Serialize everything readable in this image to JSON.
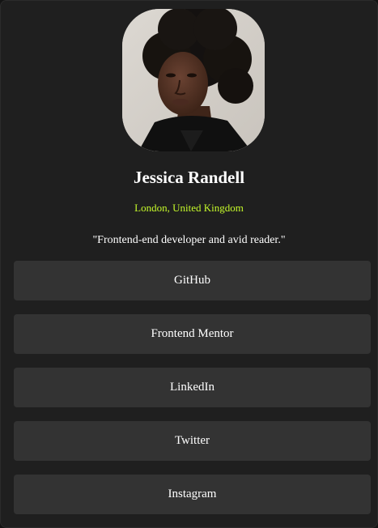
{
  "profile": {
    "name": "Jessica Randell",
    "location": "London, United Kingdom",
    "bio": "\"Frontend-end developer and avid reader.\""
  },
  "links": [
    {
      "label": "GitHub"
    },
    {
      "label": "Frontend Mentor"
    },
    {
      "label": "LinkedIn"
    },
    {
      "label": "Twitter"
    },
    {
      "label": "Instagram"
    }
  ],
  "colors": {
    "card_background": "#1f1f1f",
    "button_background": "#333333",
    "accent_green": "#c4f82a",
    "text": "#ffffff"
  }
}
